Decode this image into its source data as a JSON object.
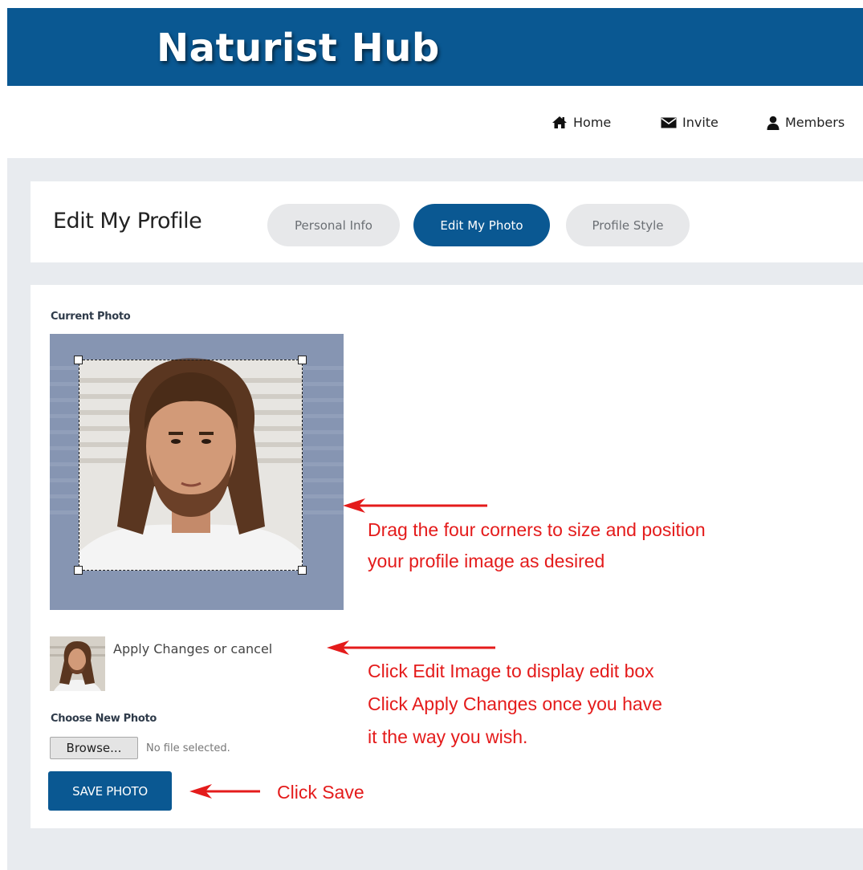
{
  "header": {
    "site_title": "Naturist Hub"
  },
  "nav": {
    "items": [
      {
        "label": "Home",
        "icon": "home-icon"
      },
      {
        "label": "Invite",
        "icon": "envelope-icon"
      },
      {
        "label": "Members",
        "icon": "user-icon"
      }
    ]
  },
  "profile": {
    "title": "Edit My Profile",
    "tabs": [
      {
        "label": "Personal Info",
        "active": false
      },
      {
        "label": "Edit My Photo",
        "active": true
      },
      {
        "label": "Profile Style",
        "active": false
      }
    ]
  },
  "photo_editor": {
    "current_photo_label": "Current Photo",
    "apply_label": "Apply Changes",
    "or_text": "or",
    "cancel_label": "cancel",
    "choose_label": "Choose New Photo",
    "browse_label": "Browse...",
    "file_status": "No file selected.",
    "save_label": "SAVE PHOTO"
  },
  "annotations": {
    "drag_line1": "Drag the four corners to size and position",
    "drag_line2": "your profile image as desired",
    "edit_line1": "Click Edit Image to display edit box",
    "edit_line2": "Click Apply Changes once you have",
    "edit_line3": "it the way you wish.",
    "save_note": "Click Save"
  },
  "colors": {
    "brand_blue": "#0a5892",
    "annotation_red": "#e41b1b",
    "app_background": "#e8ebef"
  }
}
